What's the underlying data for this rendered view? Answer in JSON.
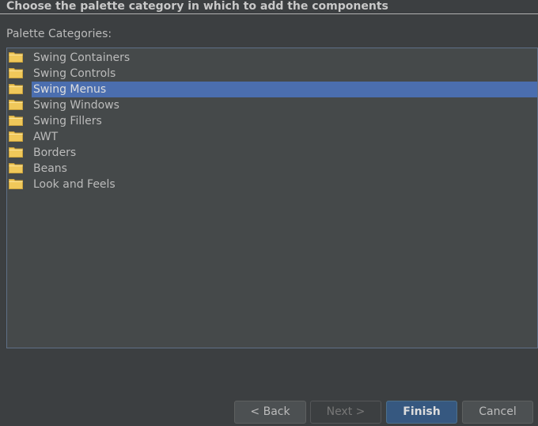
{
  "header": {
    "title": "Choose the palette category in which to add the components"
  },
  "palette": {
    "label": "Palette Categories:",
    "selected_index": 2,
    "items": [
      {
        "label": "Swing Containers",
        "icon": "folder-icon"
      },
      {
        "label": "Swing Controls",
        "icon": "folder-icon"
      },
      {
        "label": "Swing Menus",
        "icon": "folder-icon"
      },
      {
        "label": "Swing Windows",
        "icon": "folder-icon"
      },
      {
        "label": "Swing Fillers",
        "icon": "folder-icon"
      },
      {
        "label": "AWT",
        "icon": "folder-icon"
      },
      {
        "label": "Borders",
        "icon": "folder-icon"
      },
      {
        "label": "Beans",
        "icon": "folder-icon"
      },
      {
        "label": "Look and Feels",
        "icon": "folder-icon"
      }
    ]
  },
  "buttons": {
    "back": "< Back",
    "next": "Next >",
    "finish": "Finish",
    "cancel": "Cancel"
  },
  "colors": {
    "background": "#3c3f41",
    "tree_background": "#45494a",
    "selection": "#4b6eaf",
    "folder": "#f0c85a",
    "primary_button": "#365880"
  }
}
